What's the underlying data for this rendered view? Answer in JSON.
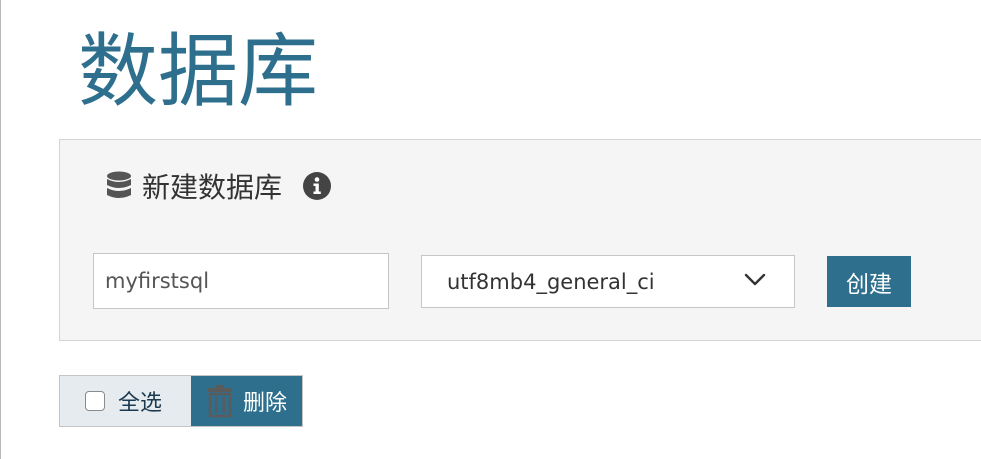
{
  "page": {
    "title": "数据库"
  },
  "create_panel": {
    "icon": "database-icon",
    "title": "新建数据库",
    "info_icon": "info-icon",
    "db_name_input": {
      "value": "myfirstsql"
    },
    "collation_select": {
      "selected": "utf8mb4_general_ci"
    },
    "create_label": "创建"
  },
  "bulk_actions": {
    "select_all_label": "全选",
    "delete_label": "删除",
    "delete_icon": "trash-icon"
  },
  "colors": {
    "accent": "#2e6f8e",
    "panel_bg": "#f5f5f5",
    "select_all_bg": "#e6ebf0"
  }
}
